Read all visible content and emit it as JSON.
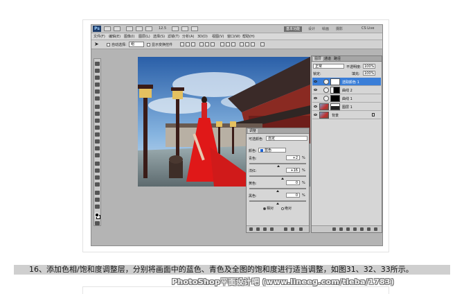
{
  "app": {
    "logo": "Ps",
    "zoom": "12.5",
    "workspaces": [
      {
        "label": "基本功能",
        "active": true
      },
      {
        "label": "设计",
        "active": false
      },
      {
        "label": "绘画",
        "active": false
      },
      {
        "label": "摄影",
        "active": false
      }
    ],
    "cslive": "CS Live"
  },
  "menu": [
    "文件(F)",
    "编辑(E)",
    "图像(I)",
    "图层(L)",
    "选择(S)",
    "滤镜(T)",
    "分析(A)",
    "3D(D)",
    "视图(V)",
    "窗口(W)",
    "帮助(H)"
  ],
  "options": {
    "auto_select": "自动选择:",
    "auto_select_value": "组",
    "show_transform": "显示变换控件"
  },
  "adjustments": {
    "tab": "调整",
    "title": "可选颜色",
    "preset": "自定",
    "color_label": "颜色:",
    "color_value": "蓝色",
    "sliders": [
      {
        "label": "青色:",
        "value": "+2",
        "level": 0.51
      },
      {
        "label": "洋红:",
        "value": "+16",
        "level": 0.58
      },
      {
        "label": "黄色:",
        "value": "0",
        "level": 0.5
      },
      {
        "label": "黑色:",
        "value": "0",
        "level": 0.5
      }
    ],
    "percent": "%",
    "mode_relative": "相对",
    "mode_absolute": "绝对"
  },
  "layers": {
    "tabs": [
      {
        "label": "图层",
        "active": true
      },
      {
        "label": "通道",
        "active": false
      },
      {
        "label": "路径",
        "active": false
      }
    ],
    "blend_mode": "正常",
    "opacity_label": "不透明度:",
    "opacity": "100%",
    "lock_label": "锁定:",
    "fill_label": "填充:",
    "fill": "100%",
    "items": [
      {
        "name": "选取颜色 1",
        "kind": "adjustment",
        "selected": true
      },
      {
        "name": "曲线 2",
        "kind": "adjustment",
        "selected": false
      },
      {
        "name": "曲线 1",
        "kind": "adjustment",
        "selected": false
      },
      {
        "name": "图层 1",
        "kind": "image",
        "selected": false
      },
      {
        "name": "背景",
        "kind": "image",
        "selected": false
      }
    ]
  },
  "caption": "16、添加色相/饱和度调整层，分别将画面中的蓝色、青色及全图的饱和度进行适当调整，如图31、32、33所示。",
  "watermark": "PhotoShop平面设计吧 (www.lineeg.com/tieba/1783)"
}
